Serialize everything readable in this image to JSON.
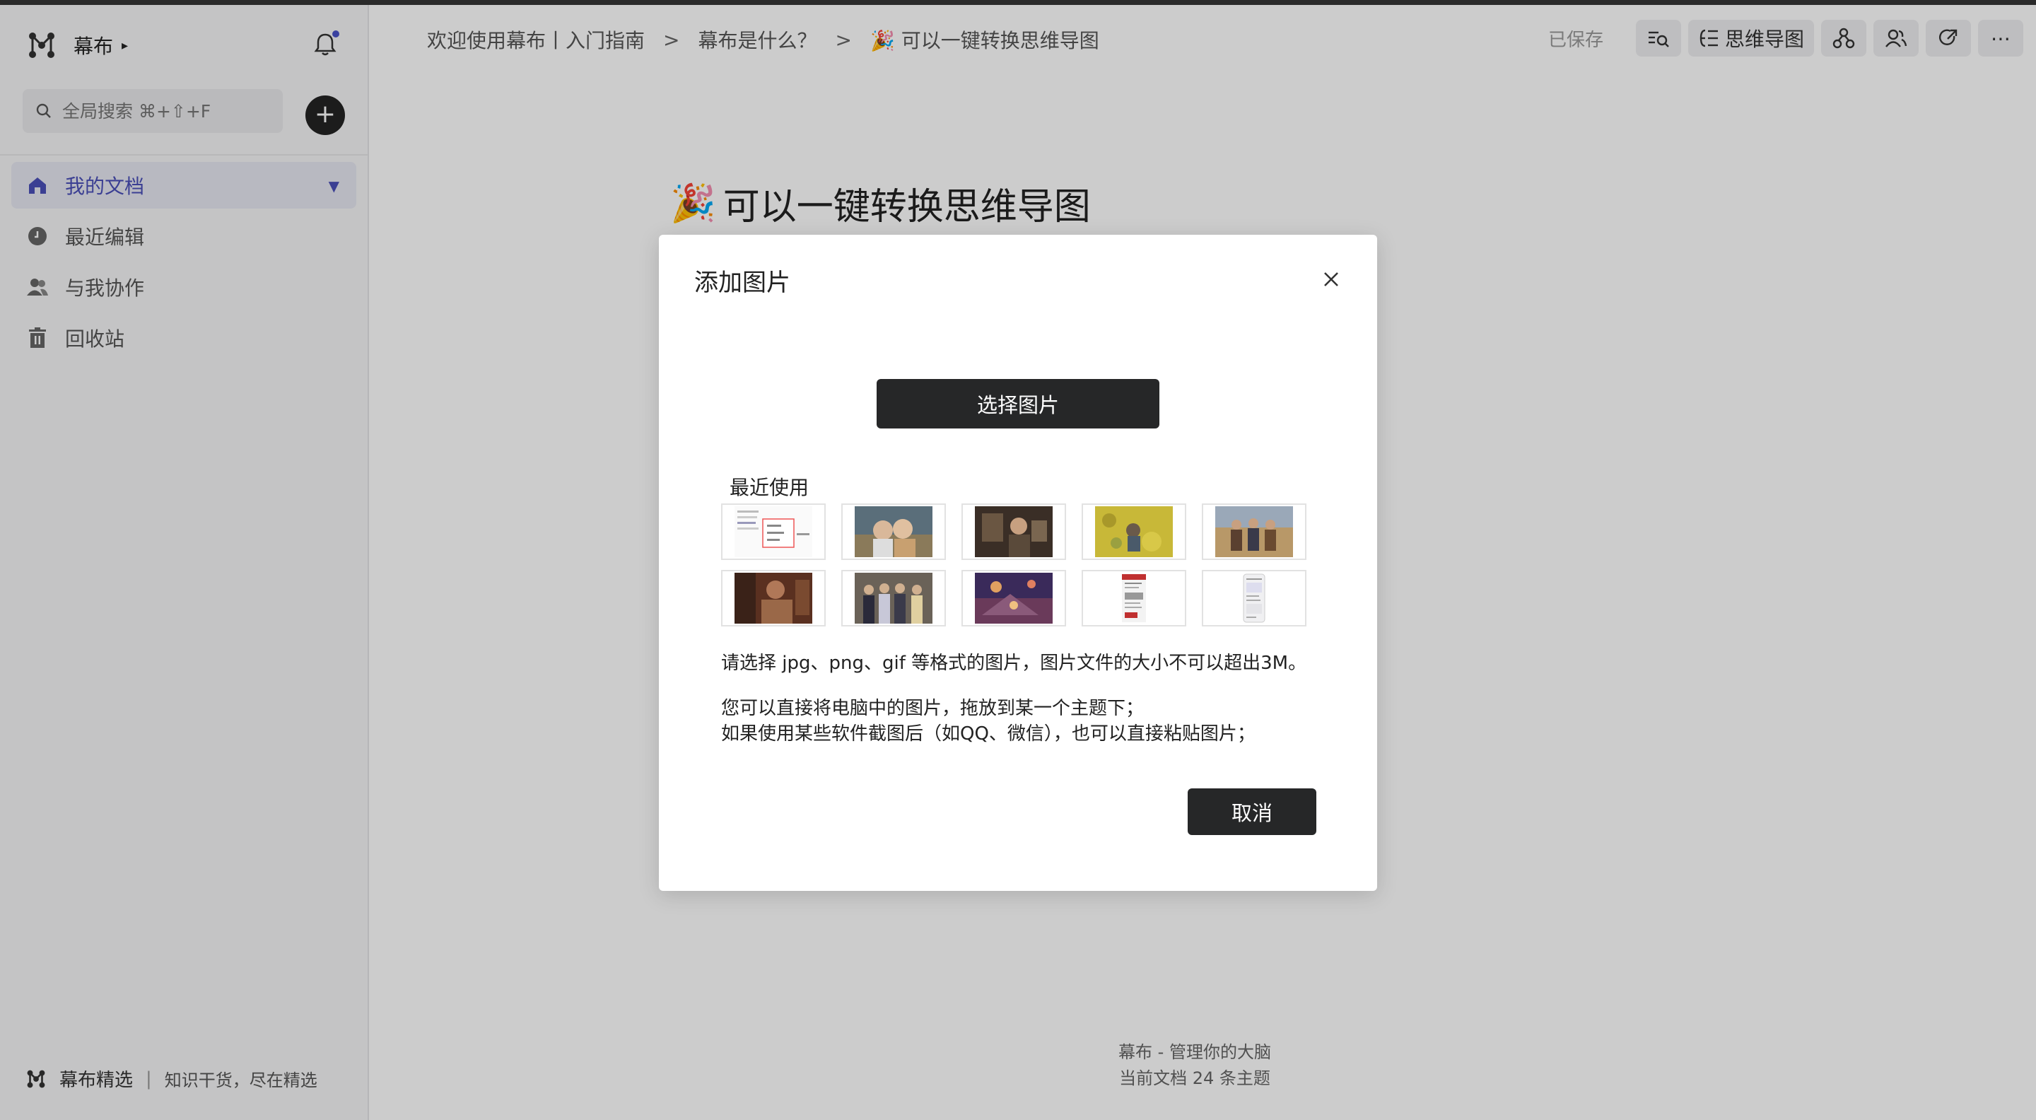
{
  "app": {
    "name": "幕布"
  },
  "sidebar": {
    "search_placeholder": "全局搜索 ⌘+⇧+F",
    "add_label": "+",
    "items": [
      {
        "label": "我的文档",
        "icon": "home-icon",
        "active": true
      },
      {
        "label": "最近编辑",
        "icon": "clock-icon",
        "active": false
      },
      {
        "label": "与我协作",
        "icon": "people-icon",
        "active": false
      },
      {
        "label": "回收站",
        "icon": "trash-icon",
        "active": false
      }
    ],
    "footer": {
      "title": "幕布精选",
      "subtitle": "知识干货，尽在精选"
    }
  },
  "breadcrumb": {
    "items": [
      "欢迎使用幕布丨入门指南",
      "幕布是什么？",
      "🎉 可以一键转换思维导图"
    ],
    "separator": ">"
  },
  "toolbar": {
    "saved": "已保存",
    "mindmap_label": "思维导图",
    "more": "⋯"
  },
  "doc": {
    "title": "可以一键转换思维导图",
    "emoji": "🎉",
    "footer_line1": "幕布 - 管理你的大脑",
    "footer_line2": "当前文档 24 条主题"
  },
  "modal": {
    "title": "添加图片",
    "select_button": "选择图片",
    "recent_label": "最近使用",
    "thumbnails": [
      {
        "name": "thumb-screenshot-1"
      },
      {
        "name": "thumb-photo-old-couple"
      },
      {
        "name": "thumb-photo-room"
      },
      {
        "name": "thumb-photo-yellow-field"
      },
      {
        "name": "thumb-photo-group-outdoor"
      },
      {
        "name": "thumb-photo-man"
      },
      {
        "name": "thumb-photo-group-formal"
      },
      {
        "name": "thumb-photo-purple-scene"
      },
      {
        "name": "thumb-screenshot-2"
      },
      {
        "name": "thumb-screenshot-3"
      }
    ],
    "info_line1": "请选择 jpg、png、gif 等格式的图片，图片文件的大小不可以超出3M。",
    "info_line2": "您可以直接将电脑中的图片，拖放到某一个主题下；",
    "info_line3": "如果使用某些软件截图后（如QQ、微信），也可以直接粘贴图片；",
    "cancel_button": "取消"
  },
  "colors": {
    "accent": "#4a4fb8",
    "dark_button": "#262728"
  }
}
